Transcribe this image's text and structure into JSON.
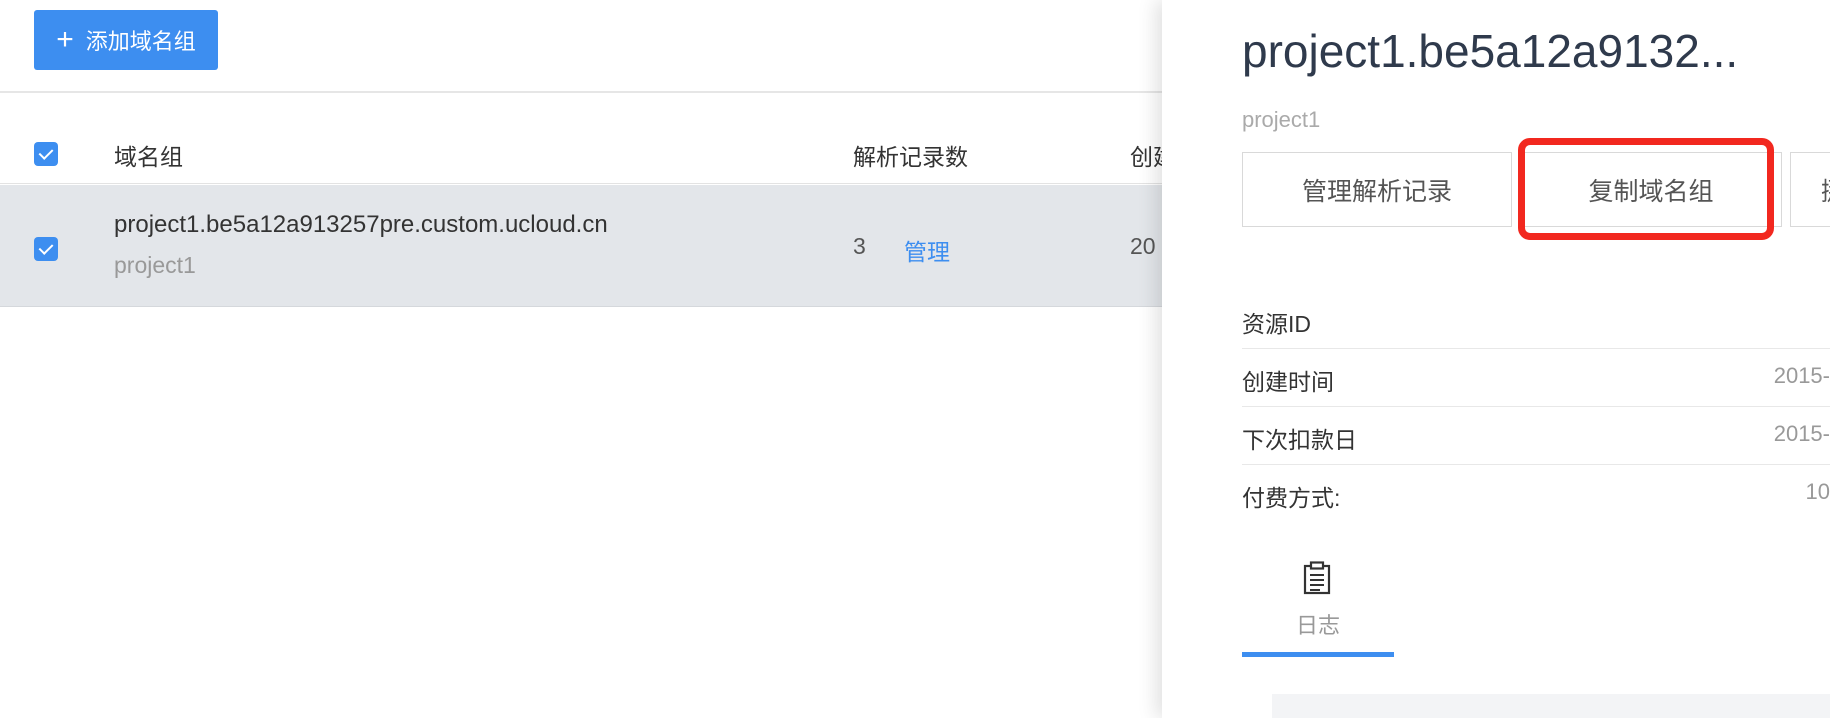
{
  "toolbar": {
    "add_button_label": "添加域名组"
  },
  "table": {
    "headers": {
      "name": "域名组",
      "count": "解析记录数",
      "created": "创建"
    },
    "rows": [
      {
        "domain": "project1.be5a12a913257pre.custom.ucloud.cn",
        "project": "project1",
        "count": "3",
        "action": "管理",
        "created": "20",
        "checked": true
      }
    ],
    "select_all_checked": true
  },
  "panel": {
    "title": "project1.be5a12a9132...",
    "subtitle": "project1",
    "actions": [
      "管理解析记录",
      "复制域名组",
      "挪"
    ],
    "info": [
      {
        "label": "资源ID",
        "value": ""
      },
      {
        "label": "创建时间",
        "value": "2015-"
      },
      {
        "label": "下次扣款日",
        "value": "2015-"
      },
      {
        "label": "付费方式:",
        "value": "10"
      }
    ],
    "tab": {
      "label": "日志",
      "icon": "clipboard-icon"
    }
  },
  "colors": {
    "accent": "#3d8ef0",
    "highlight": "#f2281f",
    "selected_row": "#e3e6ea"
  }
}
